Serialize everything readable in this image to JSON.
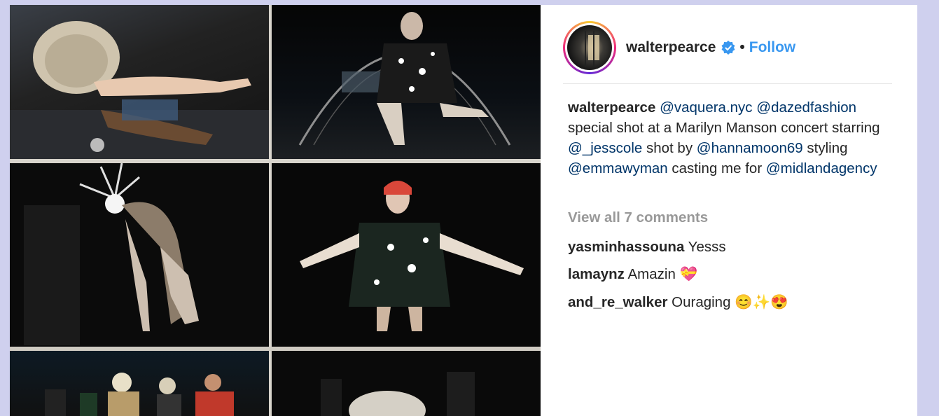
{
  "post": {
    "username": "walterpearce",
    "separator": "•",
    "follow_label": "Follow"
  },
  "caption": {
    "author": "walterpearce",
    "mentions": [
      "@vaquera.nyc",
      "@dazedfashion",
      "@_jesscole",
      "@hannamoon69",
      "@emmawyman",
      "@midlandagency"
    ],
    "text_1": "special shot at a Marilyn Manson concert",
    "text_2": "starring",
    "text_3": "shot by",
    "text_4": "styling",
    "text_5": "casting me for"
  },
  "comments": {
    "view_all_label": "View all 7 comments",
    "items": [
      {
        "user": "yasminhassouna",
        "text": "Yesss"
      },
      {
        "user": "lamaynz",
        "text": "Amazin 💝"
      },
      {
        "user": "and_re_walker",
        "text": "Ouraging 😊✨😍"
      }
    ]
  },
  "colors": {
    "follow": "#3897f0",
    "mention": "#003569",
    "page_bg": "#cfd0ee"
  }
}
